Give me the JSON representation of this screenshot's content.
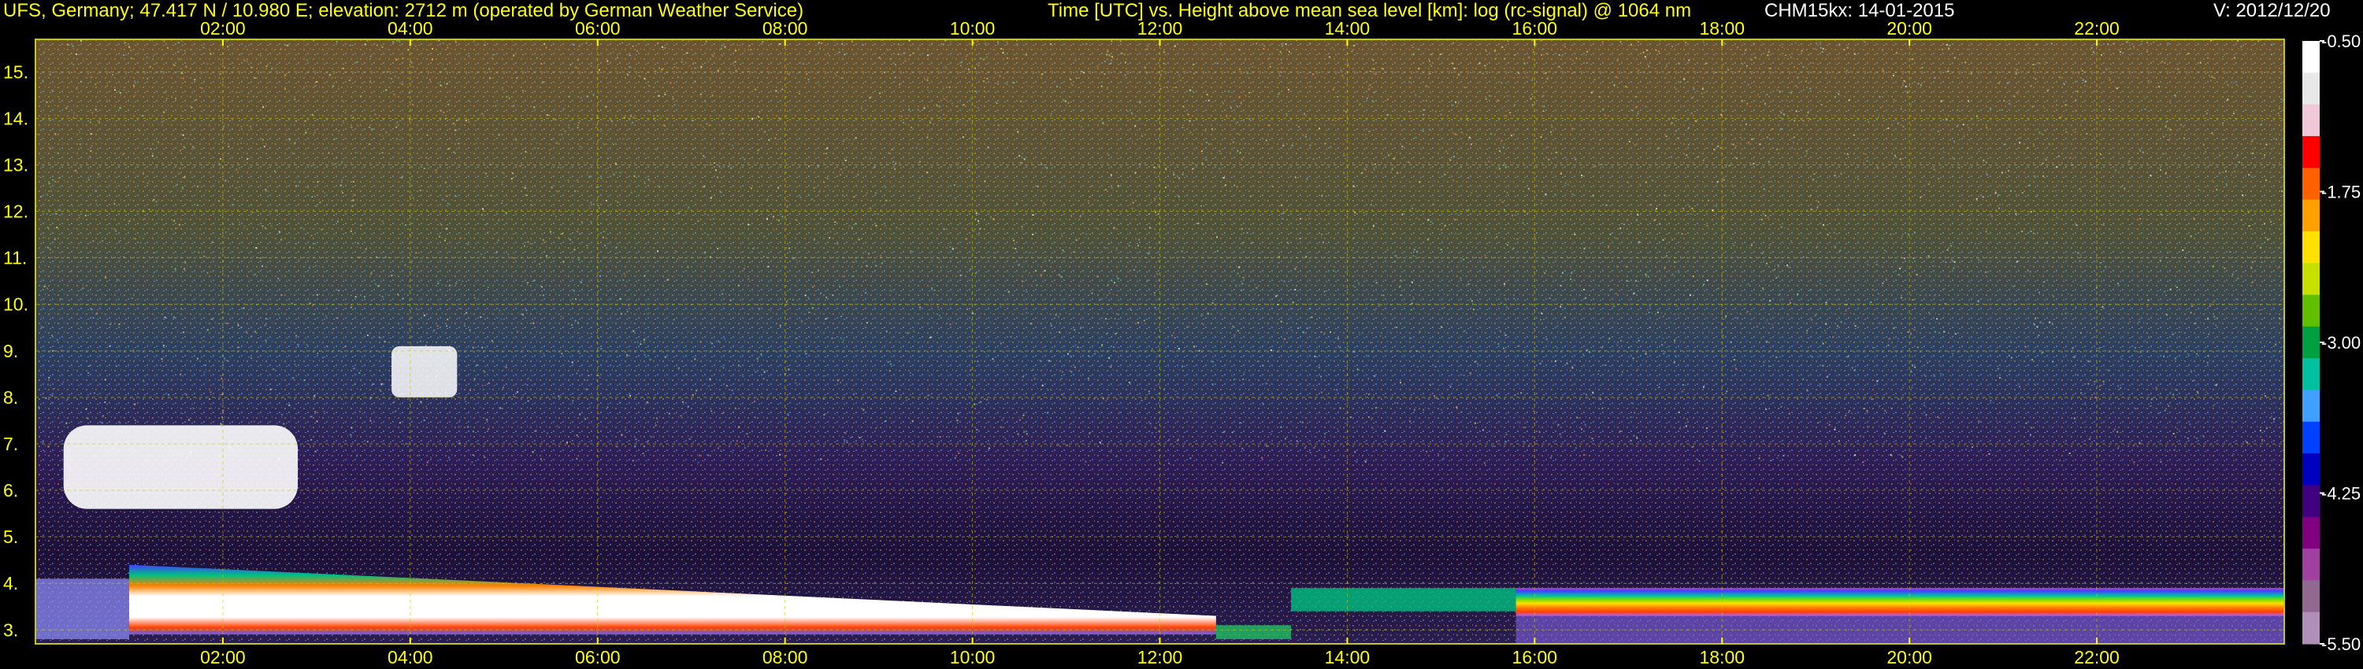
{
  "header": {
    "station": "UFS, Germany; 47.417 N / 10.980 E; elevation: 2712 m  (operated by German Weather Service)",
    "title": "Time [UTC] vs. Height above mean sea level [km]: log (rc-signal) @ 1064 nm",
    "instrument_date": "CHM15kx: 14-01-2015",
    "version": "V: 2012/12/20"
  },
  "colors": {
    "background": "#000000",
    "text": "#ffff00",
    "grid": "#c8c800",
    "noise_bg": "#6b5530",
    "noise_blue": "#3d4f78",
    "boundary_layer": "#ffffff"
  },
  "chart_data": {
    "type": "heatmap",
    "title": "Time [UTC] vs. Height above mean sea level [km]: log (rc-signal) @ 1064 nm",
    "xlabel": "Time [UTC]",
    "ylabel": "Height above mean sea level [km]",
    "x_unit": "hours UTC",
    "xlim": [
      0.0,
      24.0
    ],
    "ylim": [
      2.7,
      15.7
    ],
    "xticks": [
      2,
      4,
      6,
      8,
      10,
      12,
      14,
      16,
      18,
      20,
      22
    ],
    "xtick_labels": [
      "02:00",
      "04:00",
      "06:00",
      "08:00",
      "10:00",
      "12:00",
      "14:00",
      "16:00",
      "18:00",
      "20:00",
      "22:00"
    ],
    "yticks": [
      3,
      4,
      5,
      6,
      7,
      8,
      9,
      10,
      11,
      12,
      13,
      14,
      15
    ],
    "ytick_labels": [
      "3.",
      "4.",
      "5.",
      "6.",
      "7.",
      "8.",
      "9.",
      "10.",
      "11.",
      "12.",
      "13.",
      "14.",
      "15."
    ],
    "grid": true,
    "colorbar": {
      "range": [
        -5.5,
        -0.5
      ],
      "ticks": [
        -0.5,
        -1.75,
        -3.0,
        -4.25,
        -5.5
      ],
      "tick_labels": [
        "-0.50",
        "-1.75",
        "-3.00",
        "-4.25",
        "-5.50"
      ],
      "colors": [
        "#ffffff",
        "#e8e8e8",
        "#f0c8d8",
        "#ff0000",
        "#ff6000",
        "#ffa000",
        "#ffe000",
        "#c8e000",
        "#60c000",
        "#00a040",
        "#00c0a0",
        "#40a0ff",
        "#0040ff",
        "#0000c0",
        "#400080",
        "#800080",
        "#a040a0",
        "#906890",
        "#b090b8"
      ]
    },
    "features": [
      {
        "name": "Cloud layer",
        "t_start": 0.3,
        "t_end": 2.8,
        "h_base": 5.6,
        "h_top": 7.4
      },
      {
        "name": "Cloud layer",
        "t_start": 3.8,
        "t_end": 4.5,
        "h_base": 8.0,
        "h_top": 9.1
      },
      {
        "name": "Boundary layer top",
        "t_start": 1.0,
        "t_end": 12.6,
        "h_start": 4.4,
        "h_end": 3.3
      },
      {
        "name": "Elevated layer",
        "t_start": 15.8,
        "t_end": 24.0,
        "h_base": 3.3,
        "h_top": 3.9
      }
    ]
  }
}
